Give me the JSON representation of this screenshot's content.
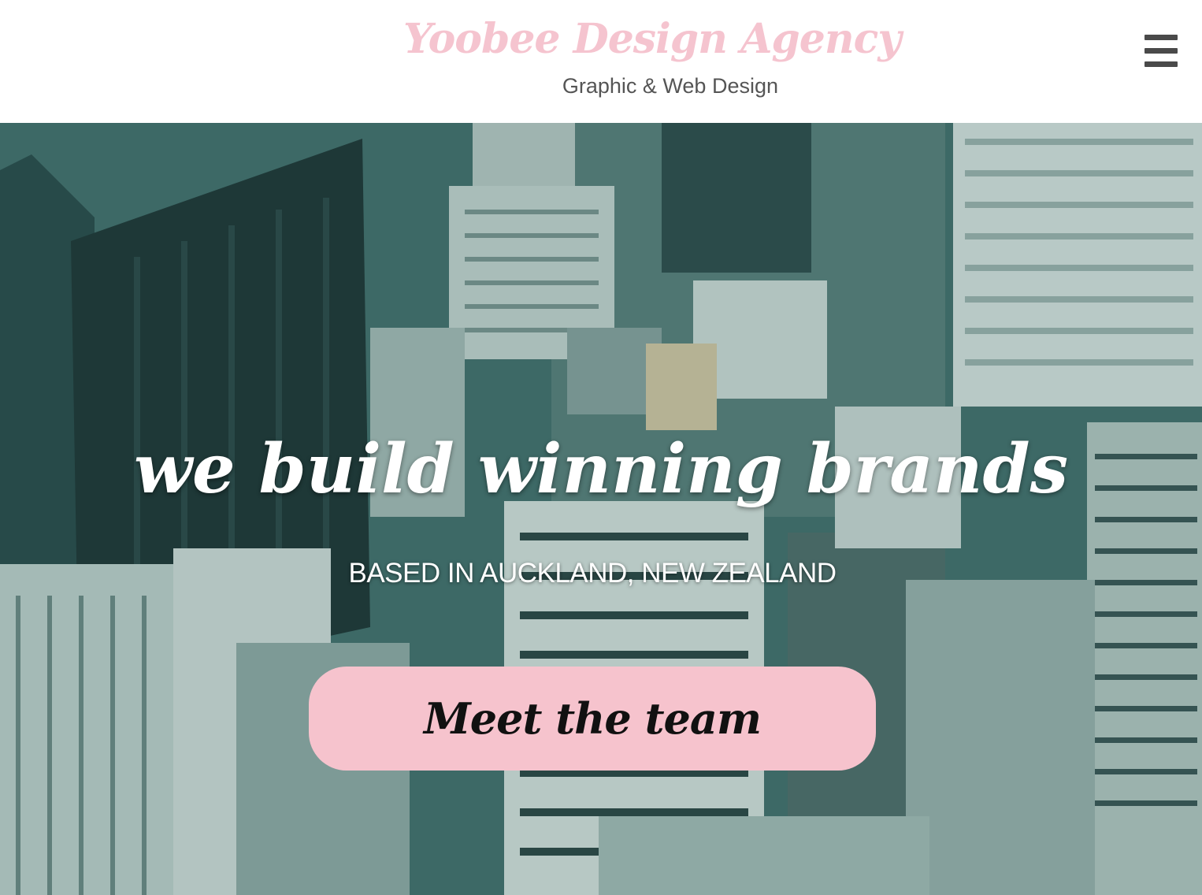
{
  "header": {
    "brand_name": "Yoobee Design Agency",
    "tagline": "Graphic & Web Design",
    "menu_icon": "hamburger-menu-icon"
  },
  "hero": {
    "background": "aerial-city-photo",
    "headline": "we build winning brands",
    "subheadline": "BASED IN AUCKLAND, NEW ZEALAND",
    "cta_label": "Meet the team"
  },
  "colors": {
    "brand_pink": "#f5c4cf",
    "cta_pink": "#f6c3cd",
    "menu_icon": "#4a4a4a",
    "tagline": "#555555",
    "hero_tint": "#3f6d6b"
  }
}
